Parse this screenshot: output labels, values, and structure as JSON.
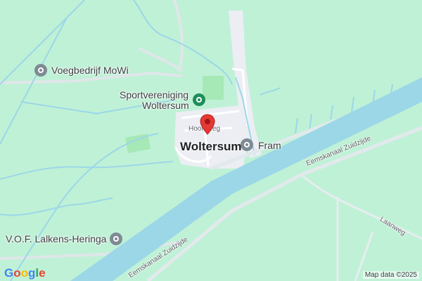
{
  "map": {
    "colors": {
      "land": "#bff1d6",
      "water": "#9cd7e8",
      "road": "#e6edee",
      "town": "#eceef4",
      "park": "#a6e8b6",
      "marker": "#e53935",
      "poi_gray": "#7e8a94",
      "poi_green": "#1e8e5a"
    },
    "pois": [
      {
        "label": "Voegbedrijf MoWi",
        "icon": "pin-gray-icon"
      },
      {
        "label_line1": "Sportvereniging",
        "label_line2": "Woltersum",
        "icon": "sports-green-icon"
      },
      {
        "label": "Fram",
        "icon": "pin-gray-icon"
      },
      {
        "label": "V.O.F. Lalkens-Heringa",
        "icon": "pin-gray-icon"
      }
    ],
    "town": {
      "label": "Woltersum"
    },
    "streets": {
      "hoofdweg": "Hoofdweg",
      "eemskanaal_upper": "Eemskanaal Zuidzijde",
      "eemskanaal_lower": "Eemskanaal Zuidzijde",
      "laanweg": "Laanweg"
    },
    "logo": "Google",
    "attribution": "Map data ©2025"
  }
}
